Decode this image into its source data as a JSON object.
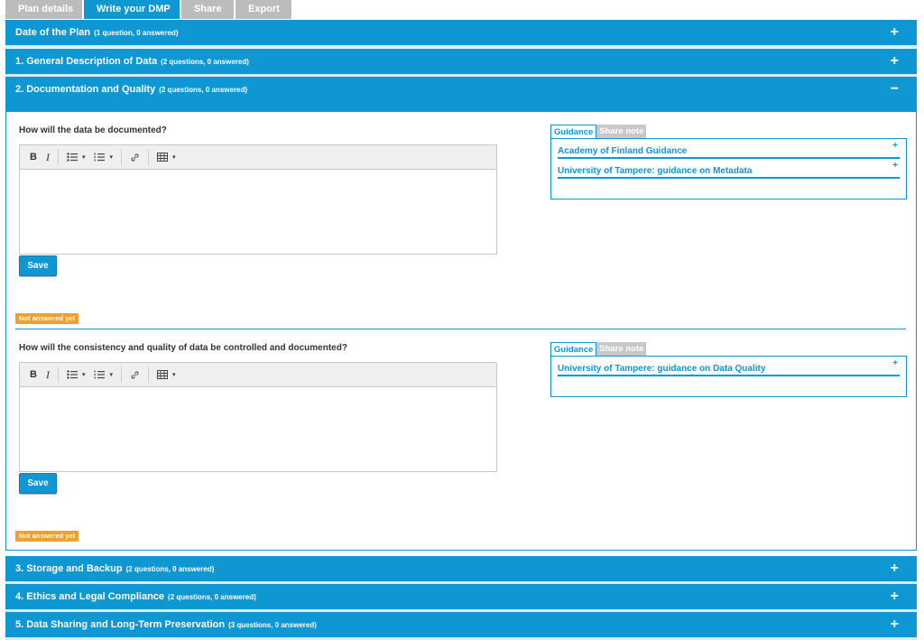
{
  "tabs": [
    {
      "label": "Plan details",
      "active": false
    },
    {
      "label": "Write your DMP",
      "active": true
    },
    {
      "label": "Share",
      "active": false
    },
    {
      "label": "Export",
      "active": false
    }
  ],
  "sections": [
    {
      "title": "Date of the Plan",
      "sub": "(1 question, 0 answered)",
      "toggle": "+"
    },
    {
      "title": "1. General Description of Data",
      "sub": "(2 questions, 0 answered)",
      "toggle": "+"
    },
    {
      "title": "2. Documentation and Quality",
      "sub": "(2 questions, 0 answered)",
      "toggle": "−"
    },
    {
      "title": "3. Storage and Backup",
      "sub": "(2 questions, 0 answered)",
      "toggle": "+"
    },
    {
      "title": "4. Ethics and Legal Compliance",
      "sub": "(2 questions, 0 answered)",
      "toggle": "+"
    },
    {
      "title": "5. Data Sharing and Long-Term Preservation",
      "sub": "(3 questions, 0 answered)",
      "toggle": "+"
    }
  ],
  "questions": [
    {
      "title": "How will the data be documented?",
      "save_label": "Save",
      "status": "Not answered yet",
      "guidance_tab": "Guidance",
      "share_tab": "Share note",
      "guidance": [
        "Academy of Finland Guidance",
        "University of Tampere: guidance on Metadata"
      ]
    },
    {
      "title": "How will the consistency and quality of data be controlled and documented?",
      "save_label": "Save",
      "status": "Not answered yet",
      "guidance_tab": "Guidance",
      "share_tab": "Share note",
      "guidance": [
        "University of Tampere: guidance on Data Quality"
      ]
    }
  ],
  "editor_toolbar": {
    "bold": "B",
    "italic": "I",
    "caret": "▾",
    "icons": [
      "bold-icon",
      "italic-icon",
      "bullet-list-icon",
      "numbered-list-icon",
      "link-icon",
      "table-icon"
    ]
  },
  "guidance_plus": "+",
  "colors": {
    "accent": "#0e97d3",
    "badge": "#f0a030",
    "tab_inactive": "#bcbcbc"
  }
}
